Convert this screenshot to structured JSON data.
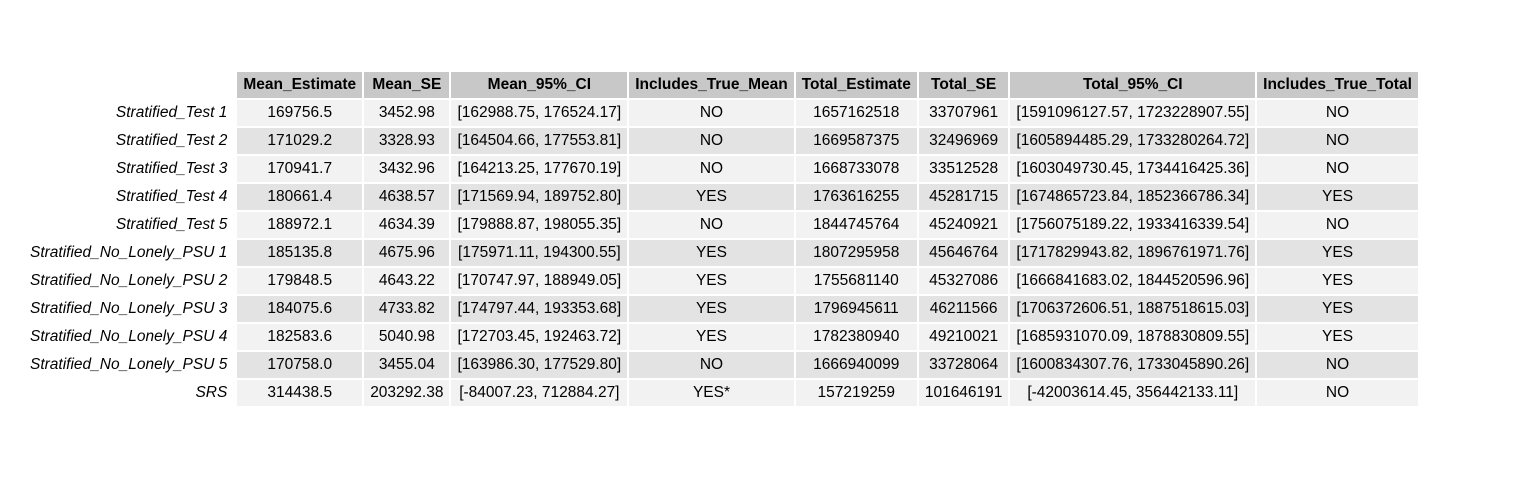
{
  "table": {
    "columns": [
      "Mean_Estimate",
      "Mean_SE",
      "Mean_95%_CI",
      "Includes_True_Mean",
      "Total_Estimate",
      "Total_SE",
      "Total_95%_CI",
      "Includes_True_Total"
    ],
    "rows": [
      {
        "label": "Stratified_Test 1",
        "cells": [
          "169756.5",
          "3452.98",
          "[162988.75, 176524.17]",
          "NO",
          "1657162518",
          "33707961",
          "[1591096127.57, 1723228907.55]",
          "NO"
        ]
      },
      {
        "label": "Stratified_Test 2",
        "cells": [
          "171029.2",
          "3328.93",
          "[164504.66, 177553.81]",
          "NO",
          "1669587375",
          "32496969",
          "[1605894485.29, 1733280264.72]",
          "NO"
        ]
      },
      {
        "label": "Stratified_Test 3",
        "cells": [
          "170941.7",
          "3432.96",
          "[164213.25, 177670.19]",
          "NO",
          "1668733078",
          "33512528",
          "[1603049730.45, 1734416425.36]",
          "NO"
        ]
      },
      {
        "label": "Stratified_Test 4",
        "cells": [
          "180661.4",
          "4638.57",
          "[171569.94, 189752.80]",
          "YES",
          "1763616255",
          "45281715",
          "[1674865723.84, 1852366786.34]",
          "YES"
        ]
      },
      {
        "label": "Stratified_Test 5",
        "cells": [
          "188972.1",
          "4634.39",
          "[179888.87, 198055.35]",
          "NO",
          "1844745764",
          "45240921",
          "[1756075189.22, 1933416339.54]",
          "NO"
        ]
      },
      {
        "label": "Stratified_No_Lonely_PSU 1",
        "cells": [
          "185135.8",
          "4675.96",
          "[175971.11, 194300.55]",
          "YES",
          "1807295958",
          "45646764",
          "[1717829943.82, 1896761971.76]",
          "YES"
        ]
      },
      {
        "label": "Stratified_No_Lonely_PSU 2",
        "cells": [
          "179848.5",
          "4643.22",
          "[170747.97, 188949.05]",
          "YES",
          "1755681140",
          "45327086",
          "[1666841683.02, 1844520596.96]",
          "YES"
        ]
      },
      {
        "label": "Stratified_No_Lonely_PSU 3",
        "cells": [
          "184075.6",
          "4733.82",
          "[174797.44, 193353.68]",
          "YES",
          "1796945611",
          "46211566",
          "[1706372606.51, 1887518615.03]",
          "YES"
        ]
      },
      {
        "label": "Stratified_No_Lonely_PSU 4",
        "cells": [
          "182583.6",
          "5040.98",
          "[172703.45, 192463.72]",
          "YES",
          "1782380940",
          "49210021",
          "[1685931070.09, 1878830809.55]",
          "YES"
        ]
      },
      {
        "label": "Stratified_No_Lonely_PSU 5",
        "cells": [
          "170758.0",
          "3455.04",
          "[163986.30, 177529.80]",
          "NO",
          "1666940099",
          "33728064",
          "[1600834307.76, 1733045890.26]",
          "NO"
        ]
      },
      {
        "label": "SRS",
        "cells": [
          "314438.5",
          "203292.38",
          "[-84007.23, 712884.27]",
          "YES*",
          "157219259",
          "101646191",
          "[-42003614.45, 356442133.11]",
          "NO"
        ]
      }
    ]
  }
}
